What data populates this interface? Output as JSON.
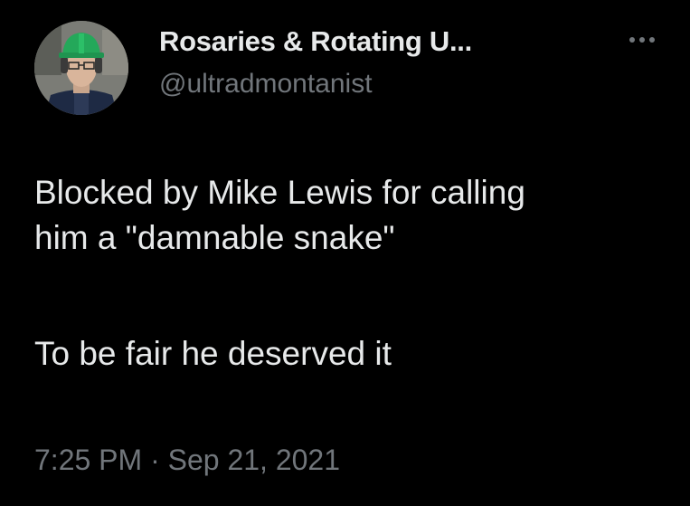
{
  "author": {
    "display_name": "Rosaries & Rotating U...",
    "handle": "@ultradmontanist"
  },
  "avatar_icon": "person-with-green-hard-hat-photo",
  "more_icon": "more-horizontal-icon",
  "tweet": {
    "lines": [
      "Blocked by Mike Lewis for calling",
      "him a \"damnable snake\"",
      "To be fair he deserved it"
    ]
  },
  "timestamp": "7:25 PM · Sep 21, 2021",
  "colors": {
    "background": "#000000",
    "primary_text": "#e7e9ea",
    "secondary_text": "#71767b"
  }
}
